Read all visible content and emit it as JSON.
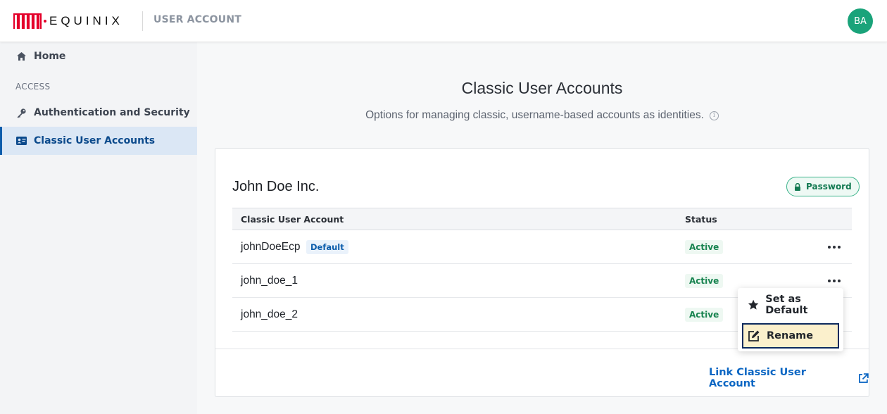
{
  "header": {
    "brand": "EQUINIX",
    "app_title": "USER ACCOUNT",
    "avatar_initials": "BA"
  },
  "sidebar": {
    "home_label": "Home",
    "section_label": "ACCESS",
    "items": [
      {
        "label": "Authentication and Security",
        "icon": "key-icon"
      },
      {
        "label": "Classic User Accounts",
        "icon": "id-card-icon",
        "active": true
      }
    ]
  },
  "main": {
    "title": "Classic User Accounts",
    "subtitle": "Options for managing classic, username-based accounts as identities.",
    "info_glyph": "i"
  },
  "card": {
    "org_name": "John Doe Inc.",
    "auth_badge": "Password",
    "columns": [
      "Classic User Account",
      "Status"
    ],
    "rows": [
      {
        "name": "johnDoeEcp",
        "tag": "Default",
        "status": "Active"
      },
      {
        "name": "john_doe_1",
        "status": "Active"
      },
      {
        "name": "john_doe_2",
        "status": "Active"
      }
    ],
    "link_label": "Link Classic User Account"
  },
  "menu": {
    "items": [
      {
        "label": "Set as Default",
        "icon": "star-icon"
      },
      {
        "label": "Rename",
        "icon": "edit-icon",
        "focused": true
      }
    ]
  },
  "colors": {
    "brand_red": "#e4002b",
    "link_blue": "#0b66c3",
    "active_green": "#17834f",
    "avatar_green": "#1aa37a"
  }
}
